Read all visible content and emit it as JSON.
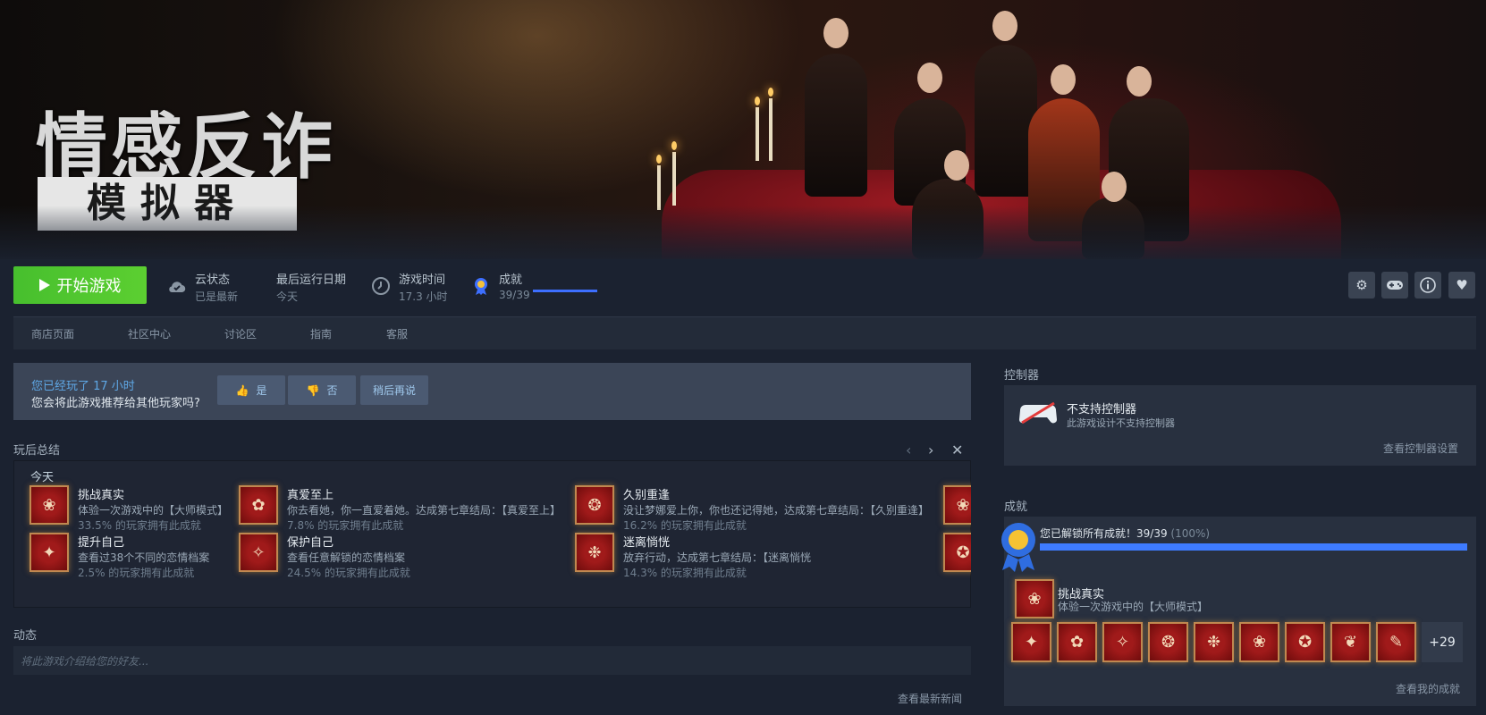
{
  "hero": {
    "logo_title": "情感反诈",
    "logo_subtitle": "模拟器"
  },
  "action_bar": {
    "play_label": "开始游戏",
    "stats": [
      {
        "label": "云状态",
        "value": "已是最新",
        "icon": "cloud-check-icon"
      },
      {
        "label": "最后运行日期",
        "value": "今天"
      },
      {
        "label": "游戏时间",
        "value": "17.3 小时",
        "icon": "clock-icon"
      },
      {
        "label": "成就",
        "value": "39/39",
        "icon": "medal-icon",
        "progress": 1.0
      }
    ],
    "icons": [
      "gear-icon",
      "gamepad-icon",
      "info-icon",
      "heart-icon"
    ]
  },
  "nav": {
    "items": [
      "商店页面",
      "社区中心",
      "讨论区",
      "指南",
      "客服"
    ]
  },
  "recommend": {
    "played_text": "您已经玩了 17 小时",
    "question": "您会将此游戏推荐给其他玩家吗?",
    "yes_label": "是",
    "no_label": "否",
    "later_label": "稍后再说"
  },
  "summary": {
    "section_label": "玩后总结",
    "today_label": "今天",
    "achievements": [
      {
        "title": "挑战真实",
        "desc": "体验一次游戏中的【大师模式】",
        "pct": "33.5% 的玩家拥有此成就",
        "glyph": "❀"
      },
      {
        "title": "真爱至上",
        "desc": "你去看她，你一直爱着她。达成第七章结局：【真爱至上】",
        "pct": "7.8% 的玩家拥有此成就",
        "glyph": "✿"
      },
      {
        "title": "久别重逢",
        "desc": "没让梦娜爱上你，你也还记得她，达成第七章结局：【久别重逢】",
        "pct": "16.2% 的玩家拥有此成就",
        "glyph": "❂"
      },
      {
        "title": "提升自己",
        "desc": "查看过38个不同的恋情档案",
        "pct": "2.5% 的玩家拥有此成就",
        "glyph": "✦"
      },
      {
        "title": "保护自己",
        "desc": "查看任意解锁的恋情档案",
        "pct": "24.5% 的玩家拥有此成就",
        "glyph": "✧"
      },
      {
        "title": "迷离惝恍",
        "desc": "放弃行动，达成第七章结局：【迷离惝恍",
        "pct": "14.3% 的玩家拥有此成就",
        "glyph": "❉"
      }
    ]
  },
  "activity": {
    "section_label": "动态",
    "placeholder": "将此游戏介绍给您的好友...",
    "news_link": "查看最新新闻"
  },
  "controller": {
    "section_label": "控制器",
    "title": "不支持控制器",
    "desc": "此游戏设计不支持控制器",
    "link": "查看控制器设置"
  },
  "achievements_panel": {
    "section_label": "成就",
    "summary_text": "您已解锁所有成就！39/39",
    "summary_pct": "(100%)",
    "progress": 1.0,
    "recent_title": "挑战真实",
    "recent_desc": "体验一次游戏中的【大师模式】",
    "more_count": "+29",
    "link": "查看我的成就",
    "badge_glyphs": [
      "✦",
      "✿",
      "✧",
      "❂",
      "❉",
      "❀",
      "✪",
      "❦",
      "✎"
    ]
  },
  "colors": {
    "play_green": "#5ccf31",
    "accent_blue": "#3e7bff",
    "link_blue": "#5fa8e6",
    "badge_red": "#a01a1a"
  }
}
